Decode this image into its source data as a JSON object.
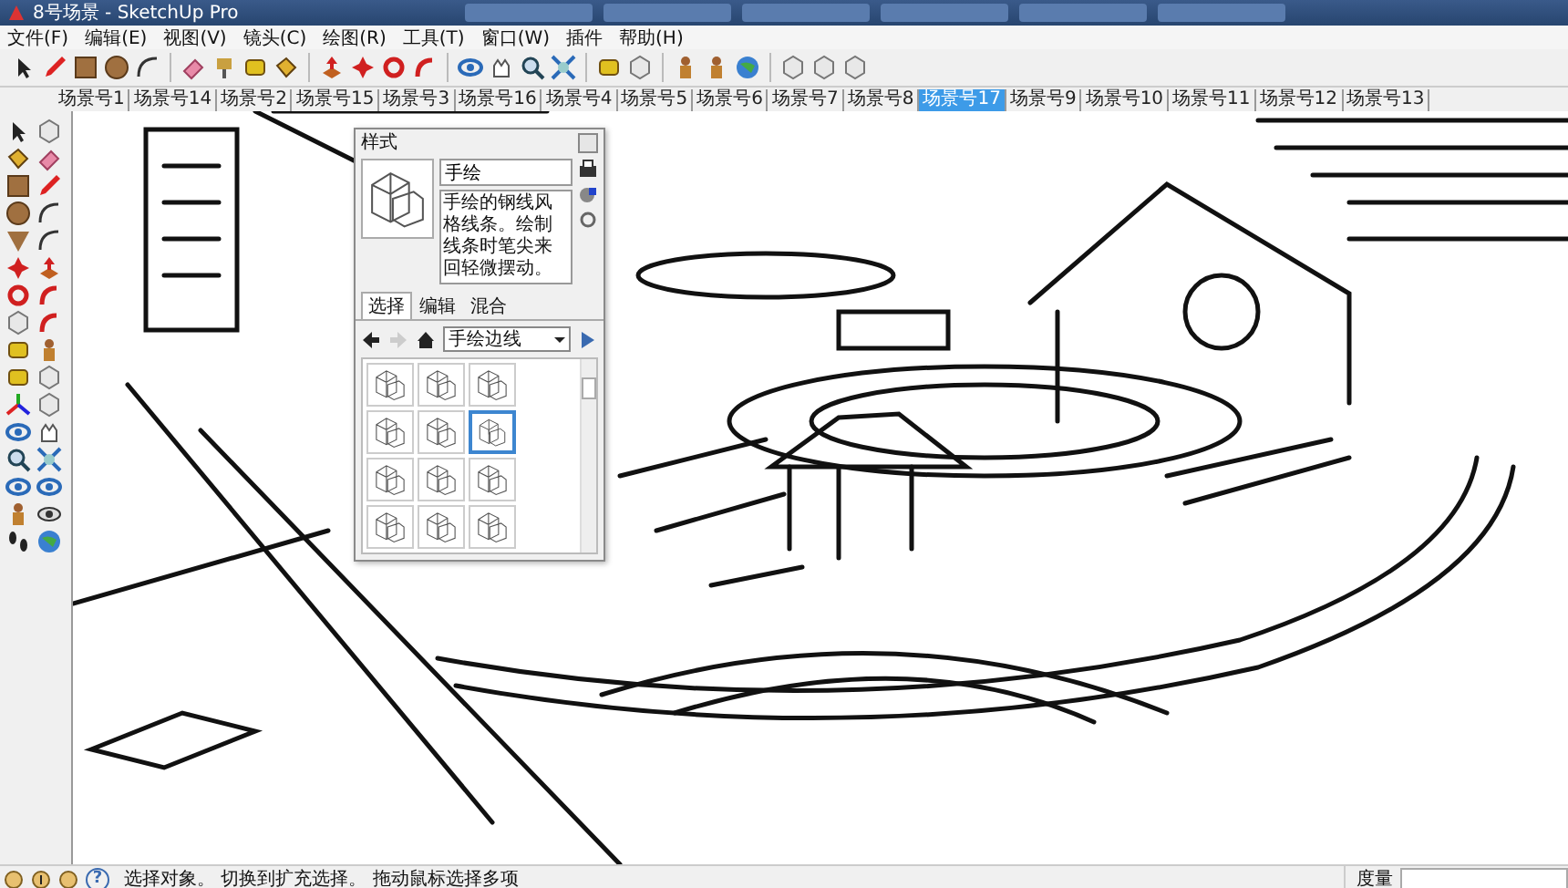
{
  "window": {
    "title": "8号场景 - SketchUp Pro"
  },
  "menu": [
    "文件(F)",
    "编辑(E)",
    "视图(V)",
    "镜头(C)",
    "绘图(R)",
    "工具(T)",
    "窗口(W)",
    "插件",
    "帮助(H)"
  ],
  "scene_tabs": [
    {
      "label": "场景号1",
      "selected": false
    },
    {
      "label": "场景号14",
      "selected": false
    },
    {
      "label": "场景号2",
      "selected": false
    },
    {
      "label": "场景号15",
      "selected": false
    },
    {
      "label": "场景号3",
      "selected": false
    },
    {
      "label": "场景号16",
      "selected": false
    },
    {
      "label": "场景号4",
      "selected": false
    },
    {
      "label": "场景号5",
      "selected": false
    },
    {
      "label": "场景号6",
      "selected": false
    },
    {
      "label": "场景号7",
      "selected": false
    },
    {
      "label": "场景号8",
      "selected": false
    },
    {
      "label": "场景号17",
      "selected": true
    },
    {
      "label": "场景号9",
      "selected": false
    },
    {
      "label": "场景号10",
      "selected": false
    },
    {
      "label": "场景号11",
      "selected": false
    },
    {
      "label": "场景号12",
      "selected": false
    },
    {
      "label": "场景号13",
      "selected": false
    }
  ],
  "styles_panel": {
    "title": "样式",
    "style_name": "手绘",
    "description": "手绘的钢线风格线条。绘制线条时笔尖来回轻微摆动。",
    "tabs": [
      {
        "label": "选择",
        "selected": true
      },
      {
        "label": "编辑",
        "selected": false
      },
      {
        "label": "混合",
        "selected": false
      }
    ],
    "collection": "手绘边线",
    "thumbnails": [
      {
        "selected": false
      },
      {
        "selected": false
      },
      {
        "selected": false
      },
      {
        "selected": false
      },
      {
        "selected": false
      },
      {
        "selected": true
      },
      {
        "selected": false
      },
      {
        "selected": false
      },
      {
        "selected": false
      },
      {
        "selected": false
      },
      {
        "selected": false
      },
      {
        "selected": false
      }
    ]
  },
  "status_bar": {
    "help_glyph": "?",
    "message": "选择对象。 切换到扩充选择。 拖动鼠标选择多项",
    "measure_label": "度量"
  }
}
